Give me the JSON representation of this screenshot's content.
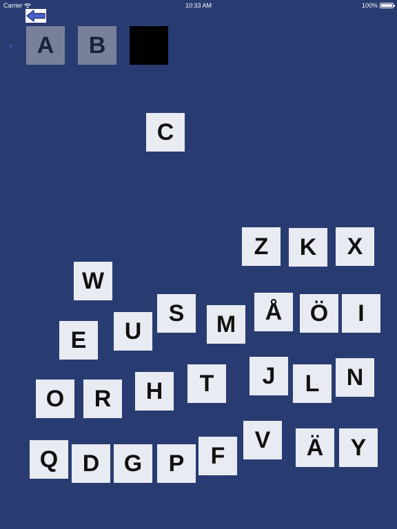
{
  "status_bar": {
    "carrier": "Carrier",
    "time": "10:33 AM",
    "battery": "100%"
  },
  "help_label": "?",
  "answer_slots": [
    {
      "letter": "A",
      "state": "filled"
    },
    {
      "letter": "B",
      "state": "filled"
    },
    {
      "letter": "",
      "state": "empty"
    }
  ],
  "tiles": [
    "C",
    "Z",
    "K",
    "X",
    "W",
    "S",
    "Å",
    "Ö",
    "I",
    "M",
    "U",
    "E",
    "J",
    "T",
    "N",
    "H",
    "L",
    "O",
    "R",
    "V",
    "Q",
    "Ä",
    "Y",
    "F",
    "D",
    "G",
    "P"
  ],
  "colors": {
    "background": "#293c72",
    "tile": "#e9ebf3",
    "slot_filled": "#79809b",
    "slot_empty": "#000000",
    "back_arrow": "#4a62c8"
  }
}
